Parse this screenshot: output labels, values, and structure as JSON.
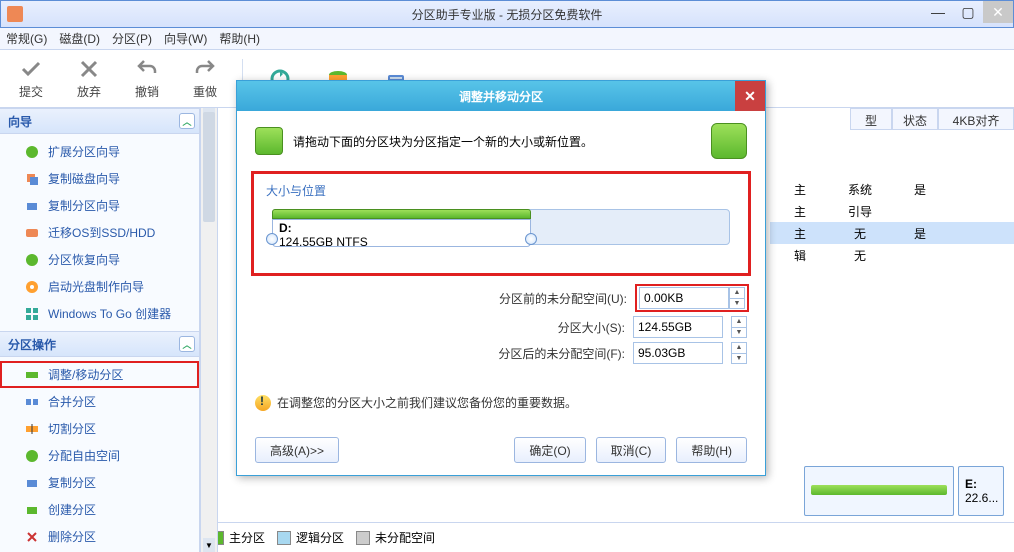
{
  "titlebar": {
    "title": "分区助手专业版 - 无损分区免费软件"
  },
  "menu": {
    "items": [
      "常规(G)",
      "磁盘(D)",
      "分区(P)",
      "向导(W)",
      "帮助(H)"
    ]
  },
  "toolbar": {
    "commit": "提交",
    "discard": "放弃",
    "undo": "撤销",
    "redo": "重做"
  },
  "sidebar": {
    "wizard": {
      "title": "向导",
      "items": [
        "扩展分区向导",
        "复制磁盘向导",
        "复制分区向导",
        "迁移OS到SSD/HDD",
        "分区恢复向导",
        "启动光盘制作向导",
        "Windows To Go 创建器"
      ]
    },
    "ops": {
      "title": "分区操作",
      "items": [
        "调整/移动分区",
        "合并分区",
        "切割分区",
        "分配自由空间",
        "复制分区",
        "创建分区",
        "删除分区"
      ]
    }
  },
  "columns": [
    "型",
    "状态",
    "4KB对齐"
  ],
  "rows": [
    {
      "c0": "主",
      "c1": "系统",
      "c2": "是",
      "sel": false
    },
    {
      "c0": "主",
      "c1": "引导",
      "c2": "",
      "sel": false
    },
    {
      "c0": "主",
      "c1": "无",
      "c2": "是",
      "sel": true
    },
    {
      "c0": "辑",
      "c1": "无",
      "c2": "",
      "sel": false
    }
  ],
  "diskmap": {
    "e_label": "E:",
    "e_size": "22.6..."
  },
  "legend": {
    "primary": "主分区",
    "logical": "逻辑分区",
    "free": "未分配空间"
  },
  "dialog": {
    "title": "调整并移动分区",
    "instruction": "请拖动下面的分区块为分区指定一个新的大小或新位置。",
    "group_label": "大小与位置",
    "drive_label": "D:",
    "drive_info": "124.55GB NTFS",
    "before_label": "分区前的未分配空间(U):",
    "before_val": "0.00KB",
    "size_label": "分区大小(S):",
    "size_val": "124.55GB",
    "after_label": "分区后的未分配空间(F):",
    "after_val": "95.03GB",
    "warn": "在调整您的分区大小之前我们建议您备份您的重要数据。",
    "advanced": "高级(A)>>",
    "ok": "确定(O)",
    "cancel": "取消(C)",
    "help": "帮助(H)"
  }
}
